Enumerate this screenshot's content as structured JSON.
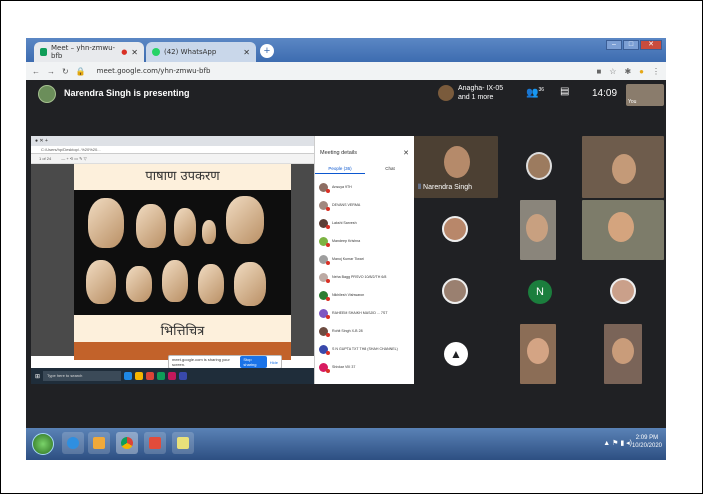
{
  "browser": {
    "tabs": [
      {
        "label": "Meet – yhn-zmwu-bfb",
        "active": true
      },
      {
        "label": "(42) WhatsApp",
        "active": false
      }
    ],
    "url": "meet.google.com/yhn-zmwu-bfb"
  },
  "meet": {
    "presenting": "Narendra Singh is presenting",
    "pinned_line1": "Anagha- IX-05",
    "pinned_line2": "and 1 more",
    "people_count": "36",
    "clock": "14:09",
    "self_label": "You"
  },
  "presentation": {
    "path": "C:/Users/hp/Desktop/..%20%20...",
    "slide_title": "पाषाण उपकरण",
    "slide_subtitle": "भित्तिचित्र",
    "share_notice": "meet.google.com is sharing your screen.",
    "stop_label": "Stop sharing",
    "hide_label": "Hide",
    "search_placeholder": "Type here to search",
    "tray_time": "2:09 PM"
  },
  "meeting_details": {
    "title": "Meeting details",
    "tab_people": "People (36)",
    "tab_chat": "Chat",
    "participants": [
      "Ansuya 9TH",
      "DEVANS VERMA",
      "Lakshi Sarvesh",
      "Mandeep Krishna",
      "Manoj Kumar Tiwari",
      "Neha Bagg PRSVO 10/8/2/TH 6/8",
      "Nikhilesh Vishwaron",
      "RAHEEM SHAIKH MASJID ... 7ST",
      "Rohit Singh X-B 28",
      "S N GUPTA TXT TH8 (SHAH CHANNEL)",
      "Shivkar VIII 37"
    ]
  },
  "participant_grid": {
    "presenter_label": "Narendra Singh",
    "n_initial": "N"
  },
  "taskbar": {
    "time": "2:09 PM",
    "date": "10/20/2020"
  }
}
